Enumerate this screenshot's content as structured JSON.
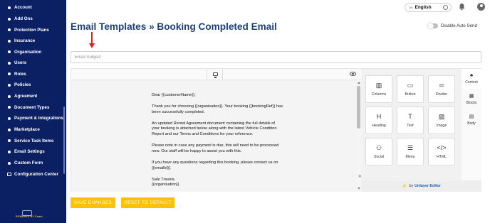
{
  "sidebar": {
    "items": [
      {
        "label": "Account",
        "icon": "dot"
      },
      {
        "label": "Add Ons",
        "icon": "dot"
      },
      {
        "label": "Protection Plans",
        "icon": "dot"
      },
      {
        "label": "Insurance",
        "icon": "dot"
      },
      {
        "label": "Organisation",
        "icon": "dot"
      },
      {
        "label": "Users",
        "icon": "dot"
      },
      {
        "label": "Roles",
        "icon": "dot"
      },
      {
        "label": "Policies",
        "icon": "dot"
      },
      {
        "label": "Agreement",
        "icon": "dot"
      },
      {
        "label": "Document Types",
        "icon": "dot"
      },
      {
        "label": "Payment & Integrations",
        "icon": "dot"
      },
      {
        "label": "Marketplace",
        "icon": "dot"
      },
      {
        "label": "Service Task Items",
        "icon": "dot"
      },
      {
        "label": "Email Settings",
        "icon": "dot"
      },
      {
        "label": "Custom Form",
        "icon": "dot"
      },
      {
        "label": "Configuration Center",
        "icon": "config-icon"
      }
    ],
    "powered_by": "POWERED BY Coast",
    "bg_color": "#0b1f63"
  },
  "header": {
    "language_flag": "US",
    "language": "English"
  },
  "page": {
    "title": "Email Templates",
    "separator": "»",
    "subtitle": "Booking Completed Email",
    "title_color": "#1d3f7a",
    "auto_send_label": "Disable Auto Send"
  },
  "subject": {
    "placeholder": "Email Subject",
    "value": ""
  },
  "email_body": {
    "greeting": "Dear {{customerName}},",
    "p1": "Thank you for choosing {{organisation}}. Your booking {{bookingRef}} has been successfully completed.",
    "p2": "An updated Rental Agreement document containing the full details of your booking is attached below along with the latest Vehicle Condition Report and our Terms and Conditions for your reference.",
    "p3": "Please note in case any payment is due, this will need to be processed now. Our staff will be happy to assist you with this.",
    "p4": "If you have any questions regarding this booking, please contact us on {{emailId}}.",
    "signoff_1": "Safe Travels,",
    "signoff_2": "{{organisation}}"
  },
  "tools": {
    "items": [
      {
        "label": "Columns",
        "icon": "columns-icon",
        "glyph": "▥"
      },
      {
        "label": "Button",
        "icon": "button-icon",
        "glyph": "▭"
      },
      {
        "label": "Divider",
        "icon": "divider-icon",
        "glyph": "═"
      },
      {
        "label": "Heading",
        "icon": "heading-icon",
        "glyph": "H"
      },
      {
        "label": "Text",
        "icon": "text-icon",
        "glyph": "T"
      },
      {
        "label": "Image",
        "icon": "image-icon",
        "glyph": "▨"
      },
      {
        "label": "Social",
        "icon": "social-icon",
        "glyph": "⚇"
      },
      {
        "label": "Menu",
        "icon": "menu-icon",
        "glyph": "☰"
      },
      {
        "label": "HTML",
        "icon": "html-icon",
        "glyph": "</>"
      }
    ]
  },
  "tabs": [
    {
      "label": "Content",
      "icon": "content-icon",
      "glyph": "♣"
    },
    {
      "label": "Blocks",
      "icon": "blocks-icon",
      "glyph": "▦"
    },
    {
      "label": "Body",
      "icon": "body-icon",
      "glyph": "▤"
    }
  ],
  "footer_brand": {
    "prefix": "by",
    "name": "Unlayer Editor"
  },
  "buttons": {
    "save": "SAVE CHANGES",
    "reset": "RESET TO DEFAULT",
    "color": "#ffc107"
  }
}
